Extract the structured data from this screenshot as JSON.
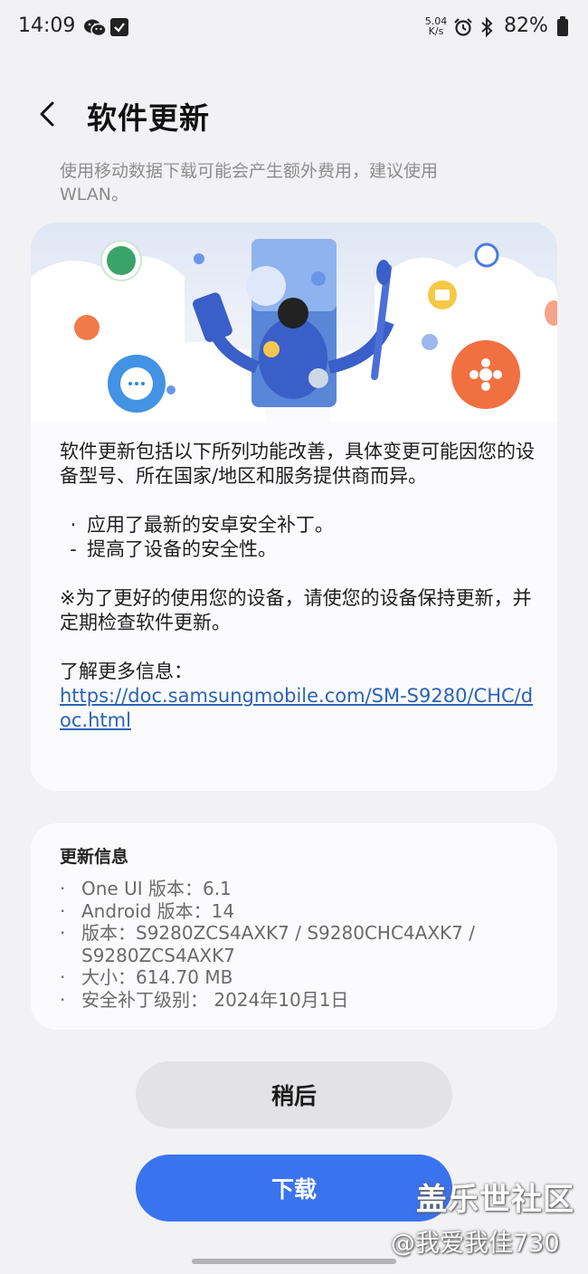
{
  "status_bar": {
    "time": "14:09",
    "net_speed_value": "5.04",
    "net_speed_unit": "K/s",
    "battery": "82%",
    "icons": [
      "wechat-icon",
      "check-icon",
      "alarm-icon",
      "bluetooth-icon",
      "battery-icon"
    ]
  },
  "header": {
    "title": "软件更新",
    "back_icon": "chevron-left-icon"
  },
  "faded_text": {
    "line1": "使用移动数据下载可能会产生额外费用，建议使用",
    "line2": "WLAN。"
  },
  "release_notes": {
    "intro": "软件更新包括以下所列功能改善，具体变更可能因您的设备型号、所在国家/地区和服务提供商而异。",
    "items": [
      {
        "mark": "·",
        "text": "应用了最新的安卓安全补丁。"
      },
      {
        "mark": "-",
        "text": "提高了设备的安全性。"
      }
    ],
    "note": "※为了更好的使用您的设备，请使您的设备保持更新，并定期检查软件更新。",
    "more_info_label": "了解更多信息：",
    "link_text": "https://doc.samsungmobile.com/SM-S9280/CHC/doc.html"
  },
  "update_info": {
    "title": "更新信息",
    "rows": [
      "One UI 版本：6.1",
      "Android 版本：14",
      "版本：S9280ZCS4AXK7 / S9280CHC4AXK7 / S9280ZCS4AXK7",
      "大小：614.70 MB",
      "安全补丁级别： 2024年10月1日"
    ]
  },
  "buttons": {
    "later": "稍后",
    "download": "下载"
  },
  "watermark": {
    "title": "盖乐世社区",
    "user": "@我爱我佳730"
  },
  "colors": {
    "accent": "#3a73ee",
    "link": "#2a63b8",
    "background": "#f2f2f4",
    "card": "#fbfbfd"
  }
}
